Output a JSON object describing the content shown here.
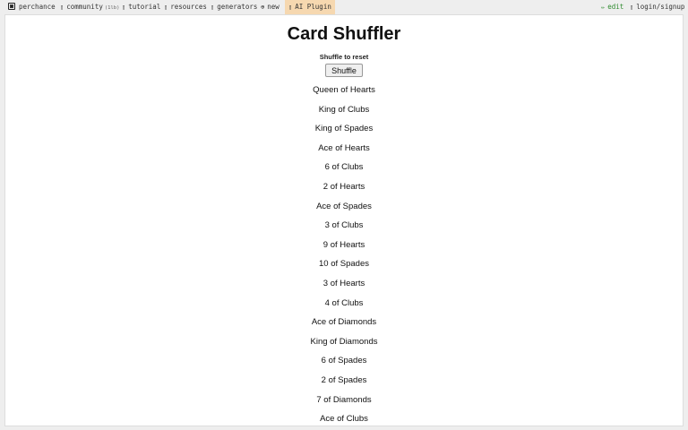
{
  "nav": {
    "brand": "perchance",
    "community_label": "community",
    "community_count": "(1lb)",
    "tutorial": "tutorial",
    "resources": "resources",
    "generators": "generators",
    "new": "new",
    "ai_plugin": "AI Plugin",
    "edit": "edit",
    "login": "login/signup"
  },
  "icons": {
    "brand": "dice-icon",
    "community": "chat-icon",
    "tutorial": "book-icon",
    "resources": "box-icon",
    "generators": "grid-icon",
    "new": "plus-circle-icon",
    "ai_plugin": "robot-icon",
    "edit": "pencil-icon",
    "login": "user-icon"
  },
  "page": {
    "title": "Card Shuffler",
    "hint": "Shuffle to reset",
    "shuffle_label": "Shuffle"
  },
  "cards": [
    "Queen of Hearts",
    "King of Clubs",
    "King of Spades",
    "Ace of Hearts",
    "6 of Clubs",
    "2 of Hearts",
    "Ace of Spades",
    "3 of Clubs",
    "9 of Hearts",
    "10 of Spades",
    "3 of Hearts",
    "4 of Clubs",
    "Ace of Diamonds",
    "King of Diamonds",
    "6 of Spades",
    "2 of Spades",
    "7 of Diamonds",
    "Ace of Clubs"
  ],
  "colors": {
    "edit": "#2e8b2e",
    "ai_plugin_bg": "#f6d8b0"
  }
}
